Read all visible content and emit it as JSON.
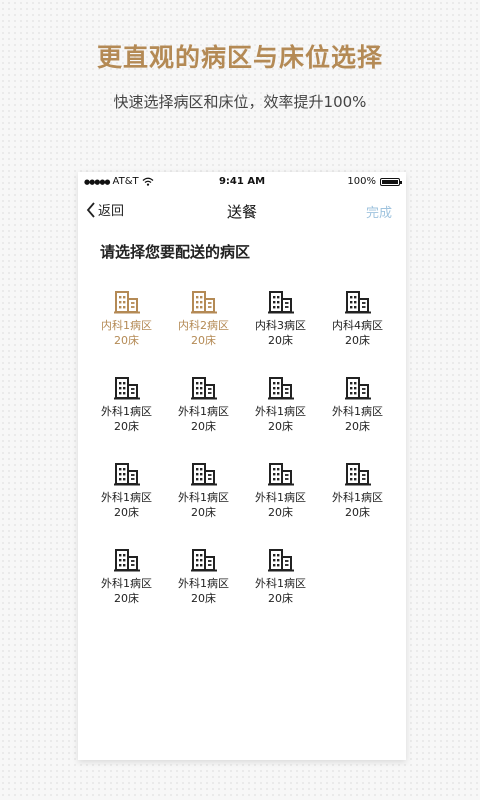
{
  "promo": {
    "headline": "更直观的病区与床位选择",
    "subline": "快速选择病区和床位，效率提升100%"
  },
  "status_bar": {
    "signal": "●●●●●",
    "carrier": "AT&T",
    "wifi_icon": "wifi-icon",
    "time": "9:41 AM",
    "battery_text": "100%",
    "battery_level": 1.0
  },
  "nav": {
    "back_label": "返回",
    "title": "送餐",
    "done_label": "完成"
  },
  "prompt": "请选择您要配送的病区",
  "colors": {
    "accent": "#b48a55",
    "done": "#9fc3de",
    "text": "#222222"
  },
  "wards": [
    {
      "name": "内科1病区",
      "beds": "20床",
      "selected": true
    },
    {
      "name": "内科2病区",
      "beds": "20床",
      "selected": true
    },
    {
      "name": "内科3病区",
      "beds": "20床",
      "selected": false
    },
    {
      "name": "内科4病区",
      "beds": "20床",
      "selected": false
    },
    {
      "name": "外科1病区",
      "beds": "20床",
      "selected": false
    },
    {
      "name": "外科1病区",
      "beds": "20床",
      "selected": false
    },
    {
      "name": "外科1病区",
      "beds": "20床",
      "selected": false
    },
    {
      "name": "外科1病区",
      "beds": "20床",
      "selected": false
    },
    {
      "name": "外科1病区",
      "beds": "20床",
      "selected": false
    },
    {
      "name": "外科1病区",
      "beds": "20床",
      "selected": false
    },
    {
      "name": "外科1病区",
      "beds": "20床",
      "selected": false
    },
    {
      "name": "外科1病区",
      "beds": "20床",
      "selected": false
    },
    {
      "name": "外科1病区",
      "beds": "20床",
      "selected": false
    },
    {
      "name": "外科1病区",
      "beds": "20床",
      "selected": false
    },
    {
      "name": "外科1病区",
      "beds": "20床",
      "selected": false
    }
  ]
}
